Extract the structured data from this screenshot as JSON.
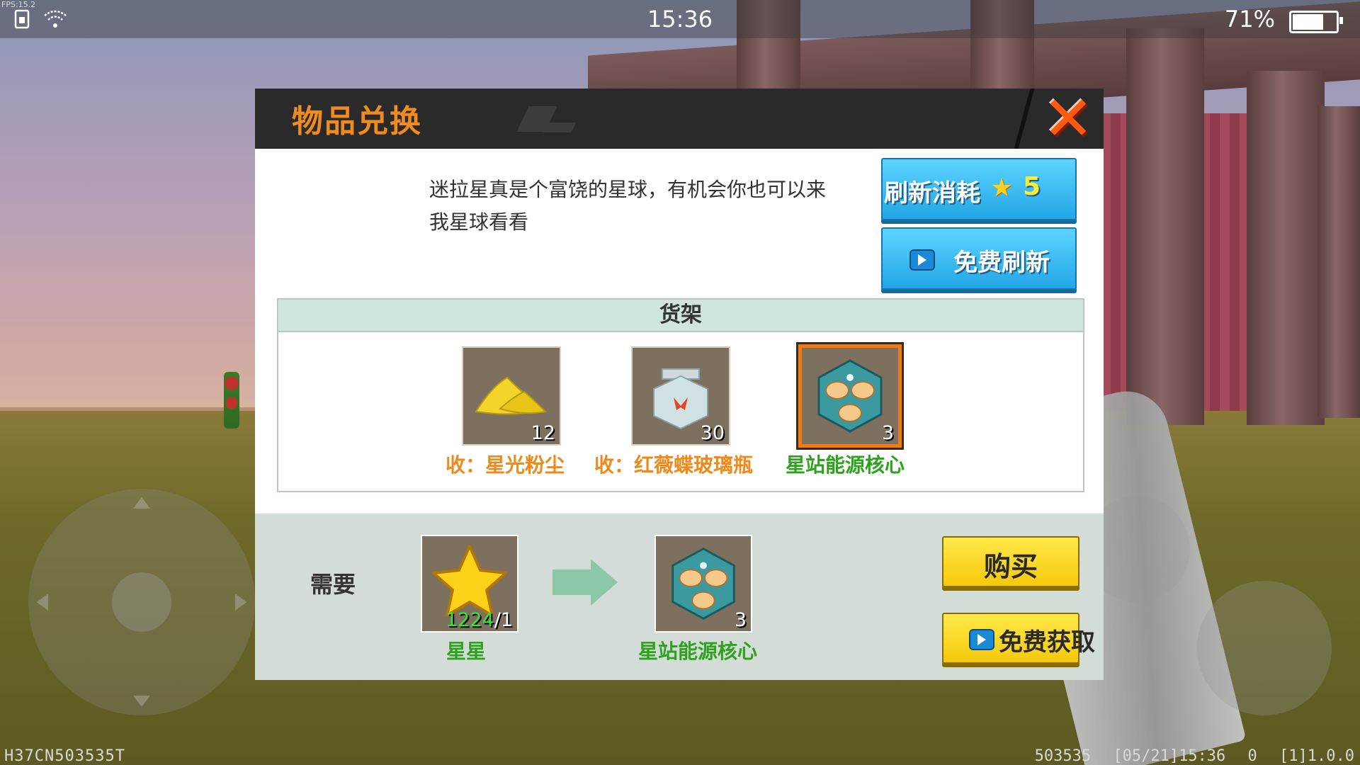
{
  "status_bar": {
    "time": "15:36",
    "battery_text": "71%",
    "battery_level": 0.71,
    "fps": "FPS:15.2"
  },
  "hud": {
    "bottom_left": "H37CN503535T",
    "bottom_right": "503535 [05/21]15:36 0 [1]1.0.0"
  },
  "dialog": {
    "title": "物品兑换",
    "description": "迷拉星真是个富饶的星球，有机会你也可以来我星球看看",
    "refresh_cost_button": {
      "label": "刷新消耗",
      "cost": "5",
      "icon": "star-icon"
    },
    "free_refresh_button": {
      "label": "免费刷新",
      "icon": "video-icon"
    },
    "shelf": {
      "title": "货架",
      "items": [
        {
          "name": "收：星光粉尘",
          "count": "12",
          "icon": "stardust-icon",
          "name_color": "#ef8a1a",
          "selected": false
        },
        {
          "name": "收：红薇蝶玻璃瓶",
          "count": "30",
          "icon": "butterfly-jar-icon",
          "name_color": "#ef8a1a",
          "selected": false
        },
        {
          "name": "星站能源核心",
          "count": "3",
          "icon": "energy-core-icon",
          "name_color": "#2ea21e",
          "selected": true
        }
      ]
    },
    "trade": {
      "need_label": "需要",
      "cost_item": {
        "name": "星星",
        "have": "1224",
        "need": "/1",
        "icon": "star-icon"
      },
      "result_item": {
        "name": "星站能源核心",
        "count": "3",
        "icon": "energy-core-icon"
      }
    },
    "buy_button": "购买",
    "free_get_button": "免费获取"
  }
}
